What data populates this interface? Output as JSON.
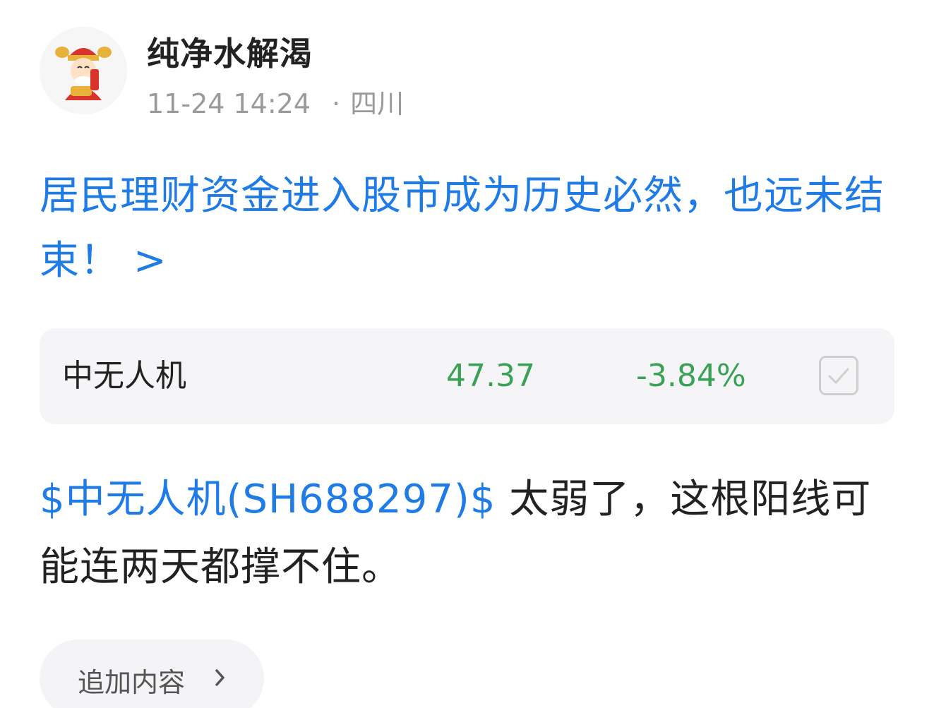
{
  "author": {
    "name": "纯净水解渴",
    "avatar_icon": "caishen-avatar-icon"
  },
  "meta": {
    "timestamp": "11-24 14:24",
    "separator": "·",
    "location": "四川"
  },
  "headline": {
    "text": "居民理财资金进入股市成为历史必然，也远未结束！",
    "arrow": ">"
  },
  "stock_card": {
    "name": "中无人机",
    "price": "47.37",
    "change": "-3.84%",
    "checkbox_icon": "check-icon"
  },
  "post": {
    "stock_tag": "$中无人机(SH688297)$",
    "text": " 太弱了，这根阳线可能连两天都撑不住。"
  },
  "add_content": {
    "label": "追加内容",
    "icon": "chevron-right-icon"
  },
  "colors": {
    "link_blue": "#1f7be6",
    "down_green": "#3aa157",
    "meta_gray": "#9a9a9a",
    "card_bg": "#f5f5f7"
  }
}
